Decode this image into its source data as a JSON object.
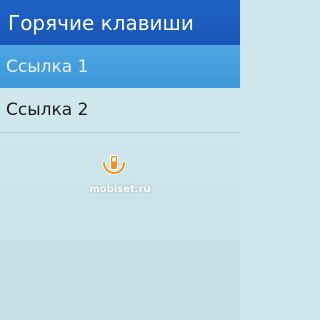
{
  "header": {
    "title": "Горячие клавиши"
  },
  "list": {
    "items": [
      {
        "label": "Ссылка 1",
        "selected": true
      },
      {
        "label": "Ссылка 2",
        "selected": false
      }
    ]
  },
  "watermark": {
    "text": "mobiset.ru"
  },
  "colors": {
    "header_bg": "#1f63c6",
    "selected_bg": "#4fa5e2",
    "screen_bg": "#cfe6ec",
    "logo_orange": "#f0901a"
  }
}
